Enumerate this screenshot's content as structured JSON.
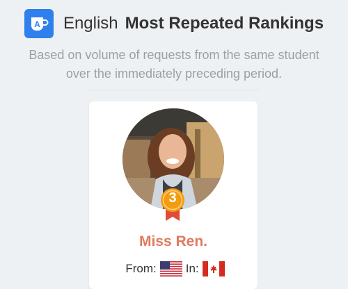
{
  "header": {
    "app_icon_letter": "A",
    "language": "English",
    "title": "Most Repeated Rankings"
  },
  "subtitle": {
    "line1": "Based on volume of requests from the same student",
    "line2": "over the immediately preceding period."
  },
  "card": {
    "rank": "3",
    "name": "Miss Ren.",
    "from_label": "From:",
    "in_label": "In:",
    "from_flag": "us-flag-icon",
    "in_flag": "canada-flag-icon"
  },
  "colors": {
    "accent_blue": "#2f80ed",
    "name_color": "#e07a5f",
    "badge_orange": "#f39c12",
    "ribbon_red": "#e04b3a"
  }
}
